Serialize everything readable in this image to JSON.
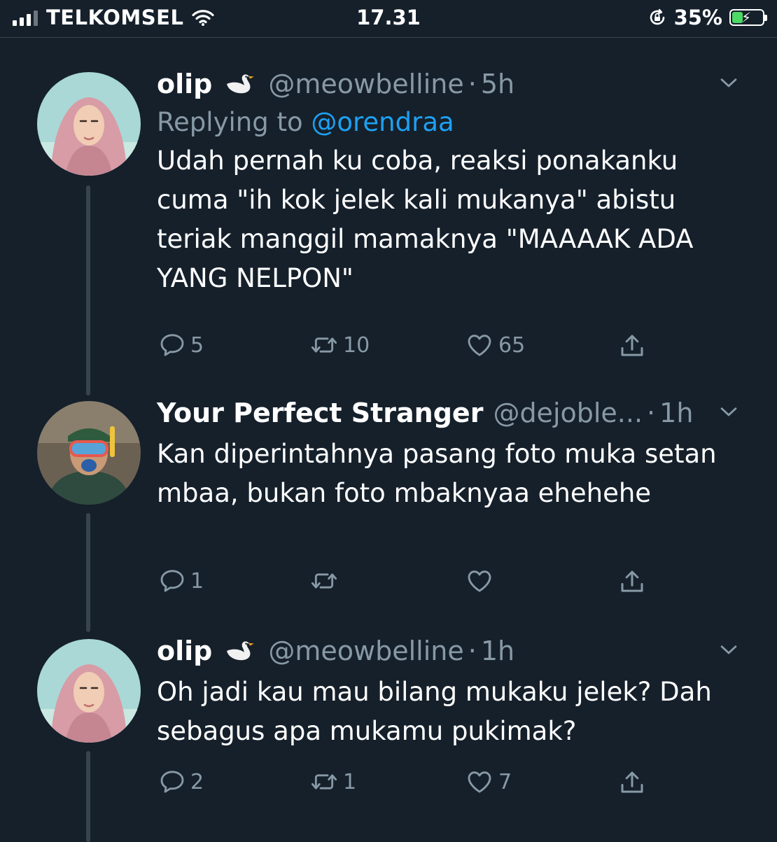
{
  "status_bar": {
    "carrier": "TELKOMSEL",
    "time": "17.31",
    "battery_percent": "35%",
    "battery_level": 0.35,
    "battery_color": "#4cd964"
  },
  "colors": {
    "background": "#15202b",
    "secondary_text": "#8899a6",
    "link": "#1da1f2",
    "divider": "#38444d"
  },
  "tweets": [
    {
      "name": "olip",
      "handle": "@meowbelline",
      "separator": "·",
      "time": "5h",
      "replying_label": "Replying to",
      "replying_to": "@orendraa",
      "text": "Udah pernah ku coba, reaksi ponakanku cuma \"ih kok jelek kali mukanya\" abistu teriak manggil mamaknya \"MAAAAK ADA YANG NELPON\"",
      "replies": "5",
      "retweets": "10",
      "likes": "65"
    },
    {
      "name": "Your Perfect Stranger",
      "handle": "@dejoble...",
      "separator": "·",
      "time": "1h",
      "text": "Kan diperintahnya pasang foto muka setan mbaa, bukan foto mbaknyaa ehehehe",
      "replies": "1",
      "retweets": "",
      "likes": ""
    },
    {
      "name": "olip",
      "handle": "@meowbelline",
      "separator": "·",
      "time": "1h",
      "text": "Oh jadi kau mau bilang mukaku jelek? Dah sebagus apa mukamu pukimak?",
      "replies": "2",
      "retweets": "1",
      "likes": "7"
    }
  ]
}
